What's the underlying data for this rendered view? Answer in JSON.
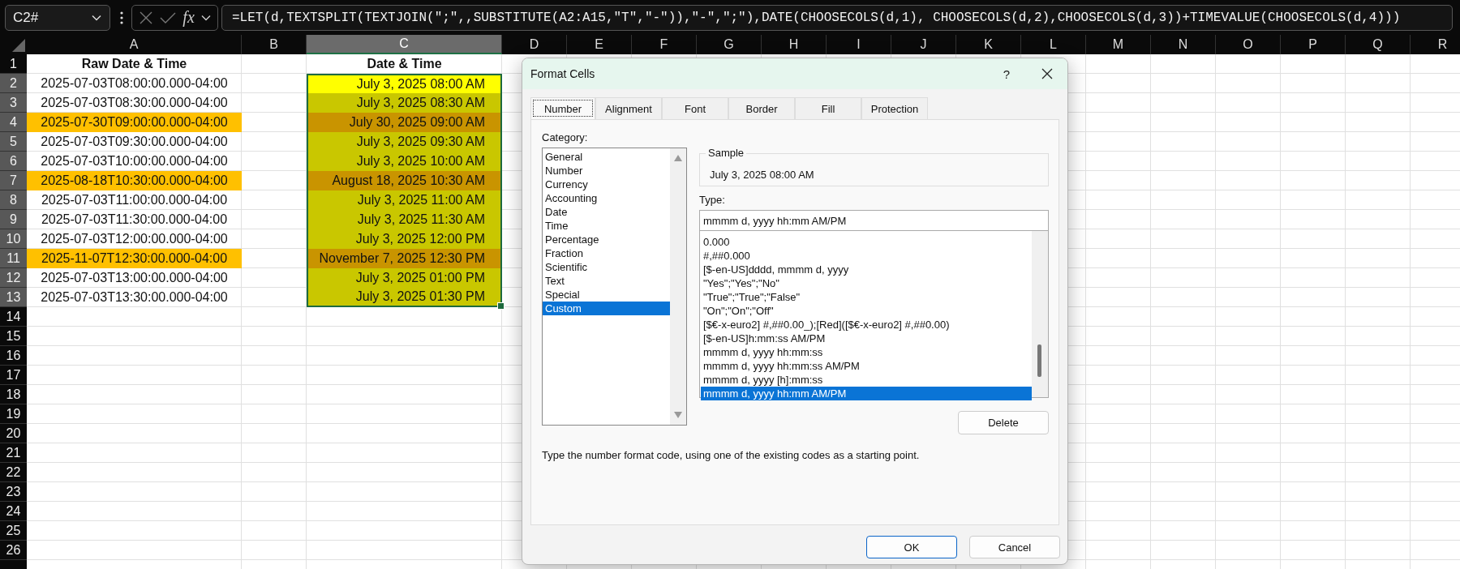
{
  "formula_bar": {
    "name_box": "C2#",
    "function_label": "fx",
    "formula": "=LET(d,TEXTSPLIT(TEXTJOIN(\";\",,SUBSTITUTE(A2:A15,\"T\",\"-\")),\"-\",\";\"),DATE(CHOOSECOLS(d,1), CHOOSECOLS(d,2),CHOOSECOLS(d,3))+TIMEVALUE(CHOOSECOLS(d,4)))"
  },
  "sheet": {
    "columns": [
      {
        "label": "A",
        "selected": false
      },
      {
        "label": "B",
        "selected": false
      },
      {
        "label": "C",
        "selected": true
      },
      {
        "label": "D",
        "selected": false
      },
      {
        "label": "E",
        "selected": false
      },
      {
        "label": "F",
        "selected": false
      },
      {
        "label": "G",
        "selected": false
      },
      {
        "label": "H",
        "selected": false
      },
      {
        "label": "I",
        "selected": false
      },
      {
        "label": "J",
        "selected": false
      },
      {
        "label": "K",
        "selected": false
      },
      {
        "label": "L",
        "selected": false
      },
      {
        "label": "M",
        "selected": false
      },
      {
        "label": "N",
        "selected": false
      },
      {
        "label": "O",
        "selected": false
      },
      {
        "label": "P",
        "selected": false
      },
      {
        "label": "Q",
        "selected": false
      },
      {
        "label": "R",
        "selected": false
      }
    ],
    "rows": [
      {
        "number": "1",
        "selected": false,
        "kind": "header",
        "a": {
          "text": "Raw Date & Time"
        },
        "c": {
          "text": "Date & Time"
        }
      },
      {
        "number": "2",
        "selected": true,
        "kind": "data",
        "a": {
          "text": "2025-07-03T08:00:00.000-04:00"
        },
        "c": {
          "text": "July 3, 2025 08:00 AM",
          "color": "#ffff00"
        }
      },
      {
        "number": "3",
        "selected": true,
        "kind": "data",
        "a": {
          "text": "2025-07-03T08:30:00.000-04:00"
        },
        "c": {
          "text": "July 3, 2025 08:30 AM",
          "color": "#c9c700"
        }
      },
      {
        "number": "4",
        "selected": true,
        "kind": "data",
        "a": {
          "text": "2025-07-30T09:00:00.000-04:00",
          "color": "#ffc000"
        },
        "c": {
          "text": "July 30, 2025 09:00 AM",
          "color": "#c99400"
        }
      },
      {
        "number": "5",
        "selected": true,
        "kind": "data",
        "a": {
          "text": "2025-07-03T09:30:00.000-04:00"
        },
        "c": {
          "text": "July 3, 2025 09:30 AM",
          "color": "#c9c700"
        }
      },
      {
        "number": "6",
        "selected": true,
        "kind": "data",
        "a": {
          "text": "2025-07-03T10:00:00.000-04:00"
        },
        "c": {
          "text": "July 3, 2025 10:00 AM",
          "color": "#c9c700"
        }
      },
      {
        "number": "7",
        "selected": true,
        "kind": "data",
        "a": {
          "text": "2025-08-18T10:30:00.000-04:00",
          "color": "#ffc000"
        },
        "c": {
          "text": "August 18, 2025 10:30 AM",
          "color": "#c99400"
        }
      },
      {
        "number": "8",
        "selected": true,
        "kind": "data",
        "a": {
          "text": "2025-07-03T11:00:00.000-04:00"
        },
        "c": {
          "text": "July 3, 2025 11:00 AM",
          "color": "#c9c700"
        }
      },
      {
        "number": "9",
        "selected": true,
        "kind": "data",
        "a": {
          "text": "2025-07-03T11:30:00.000-04:00"
        },
        "c": {
          "text": "July 3, 2025 11:30 AM",
          "color": "#c9c700"
        }
      },
      {
        "number": "10",
        "selected": true,
        "kind": "data",
        "a": {
          "text": "2025-07-03T12:00:00.000-04:00"
        },
        "c": {
          "text": "July 3, 2025 12:00 PM",
          "color": "#c9c700"
        }
      },
      {
        "number": "11",
        "selected": true,
        "kind": "data",
        "a": {
          "text": "2025-11-07T12:30:00.000-04:00",
          "color": "#ffc000"
        },
        "c": {
          "text": "November 7, 2025 12:30 PM",
          "color": "#c99400"
        }
      },
      {
        "number": "12",
        "selected": true,
        "kind": "data",
        "a": {
          "text": "2025-07-03T13:00:00.000-04:00"
        },
        "c": {
          "text": "July 3, 2025 01:00 PM",
          "color": "#c9c700"
        }
      },
      {
        "number": "13",
        "selected": true,
        "kind": "data",
        "a": {
          "text": "2025-07-03T13:30:00.000-04:00"
        },
        "c": {
          "text": "July 3, 2025 01:30 PM",
          "color": "#c9c700"
        }
      },
      {
        "number": "14",
        "selected": false
      },
      {
        "number": "15",
        "selected": false
      },
      {
        "number": "16",
        "selected": false
      },
      {
        "number": "17",
        "selected": false
      },
      {
        "number": "18",
        "selected": false
      },
      {
        "number": "19",
        "selected": false
      },
      {
        "number": "20",
        "selected": false
      },
      {
        "number": "21",
        "selected": false
      },
      {
        "number": "22",
        "selected": false
      },
      {
        "number": "23",
        "selected": false
      },
      {
        "number": "24",
        "selected": false
      },
      {
        "number": "25",
        "selected": false
      },
      {
        "number": "26",
        "selected": false
      }
    ]
  },
  "dialog": {
    "title": "Format Cells",
    "help_button": "?",
    "tabs": [
      {
        "label": "Number",
        "selected": true
      },
      {
        "label": "Alignment",
        "selected": false
      },
      {
        "label": "Font",
        "selected": false
      },
      {
        "label": "Border",
        "selected": false
      },
      {
        "label": "Fill",
        "selected": false
      },
      {
        "label": "Protection",
        "selected": false
      }
    ],
    "category_label": "Category:",
    "categories": [
      {
        "label": "General",
        "selected": false
      },
      {
        "label": "Number",
        "selected": false
      },
      {
        "label": "Currency",
        "selected": false
      },
      {
        "label": "Accounting",
        "selected": false
      },
      {
        "label": "Date",
        "selected": false
      },
      {
        "label": "Time",
        "selected": false
      },
      {
        "label": "Percentage",
        "selected": false
      },
      {
        "label": "Fraction",
        "selected": false
      },
      {
        "label": "Scientific",
        "selected": false
      },
      {
        "label": "Text",
        "selected": false
      },
      {
        "label": "Special",
        "selected": false
      },
      {
        "label": "Custom",
        "selected": true
      }
    ],
    "sample": {
      "label": "Sample",
      "value": "July 3, 2025 08:00 AM"
    },
    "type": {
      "label": "Type:",
      "value": "mmmm d, yyyy hh:mm AM/PM"
    },
    "formats": [
      {
        "label": "0.000",
        "selected": false
      },
      {
        "label": "#,##0.000",
        "selected": false
      },
      {
        "label": "[$-en-US]dddd, mmmm d, yyyy",
        "selected": false
      },
      {
        "label": "\"Yes\";\"Yes\";\"No\"",
        "selected": false
      },
      {
        "label": "\"True\";\"True\";\"False\"",
        "selected": false
      },
      {
        "label": "\"On\";\"On\";\"Off\"",
        "selected": false
      },
      {
        "label": "[$€-x-euro2] #,##0.00_);[Red]([$€-x-euro2] #,##0.00)",
        "selected": false
      },
      {
        "label": "[$-en-US]h:mm:ss AM/PM",
        "selected": false
      },
      {
        "label": "mmmm d, yyyy hh:mm:ss",
        "selected": false
      },
      {
        "label": "mmmm d, yyyy hh:mm:ss AM/PM",
        "selected": false
      },
      {
        "label": "mmmm d, yyyy [h]:mm:ss",
        "selected": false
      },
      {
        "label": "mmmm d, yyyy hh:mm AM/PM",
        "selected": true
      }
    ],
    "delete_button": "Delete",
    "hint": "Type the number format code, using one of the existing codes as a starting point.",
    "buttons": [
      {
        "label": "OK",
        "kind": "default"
      },
      {
        "label": "Cancel",
        "kind": "normal"
      }
    ]
  }
}
